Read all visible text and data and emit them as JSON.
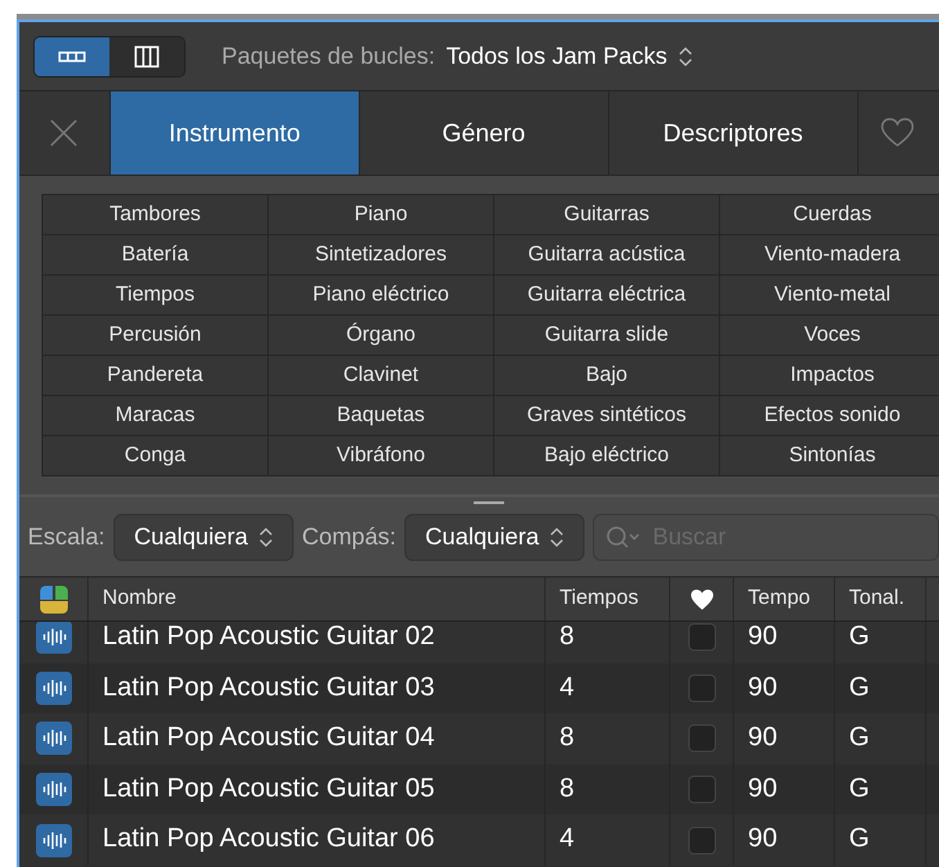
{
  "toolbar": {
    "view_buttons": [
      {
        "kind": "list",
        "selected": true
      },
      {
        "kind": "columns",
        "selected": false
      }
    ],
    "label": "Paquetes de bucles:",
    "value": "Todos los Jam Packs"
  },
  "tabs": [
    {
      "label": "Instrumento",
      "selected": true
    },
    {
      "label": "Género",
      "selected": false
    },
    {
      "label": "Descriptores",
      "selected": false
    }
  ],
  "keywords": [
    [
      "Tambores",
      "Piano",
      "Guitarras",
      "Cuerdas"
    ],
    [
      "Batería",
      "Sintetizadores",
      "Guitarra acústica",
      "Viento-madera"
    ],
    [
      "Tiempos",
      "Piano eléctrico",
      "Guitarra eléctrica",
      "Viento-metal"
    ],
    [
      "Percusión",
      "Órgano",
      "Guitarra slide",
      "Voces"
    ],
    [
      "Pandereta",
      "Clavinet",
      "Bajo",
      "Impactos"
    ],
    [
      "Maracas",
      "Baquetas",
      "Graves sintéticos",
      "Efectos sonido"
    ],
    [
      "Conga",
      "Vibráfono",
      "Bajo eléctrico",
      "Sintonías"
    ]
  ],
  "filters": {
    "scale_label": "Escala:",
    "scale_value": "Cualquiera",
    "meter_label": "Compás:",
    "meter_value": "Cualquiera",
    "search_placeholder": "Buscar"
  },
  "table": {
    "columns": [
      {
        "kind": "name",
        "label": "Nombre"
      },
      {
        "kind": "beats",
        "label": "Tiempos"
      },
      {
        "kind": "favorite"
      },
      {
        "kind": "tempo",
        "label": "Tempo"
      },
      {
        "kind": "key",
        "label": "Tonal."
      }
    ],
    "rows": [
      {
        "name": "Latin Pop Acoustic Guitar 02",
        "beats": "8",
        "favorite": false,
        "tempo": "90",
        "key": "G"
      },
      {
        "name": "Latin Pop Acoustic Guitar 03",
        "beats": "4",
        "favorite": false,
        "tempo": "90",
        "key": "G"
      },
      {
        "name": "Latin Pop Acoustic Guitar 04",
        "beats": "8",
        "favorite": false,
        "tempo": "90",
        "key": "G"
      },
      {
        "name": "Latin Pop Acoustic Guitar 05",
        "beats": "8",
        "favorite": false,
        "tempo": "90",
        "key": "G"
      },
      {
        "name": "Latin Pop Acoustic Guitar 06",
        "beats": "4",
        "favorite": false,
        "tempo": "90",
        "key": "G"
      }
    ]
  }
}
